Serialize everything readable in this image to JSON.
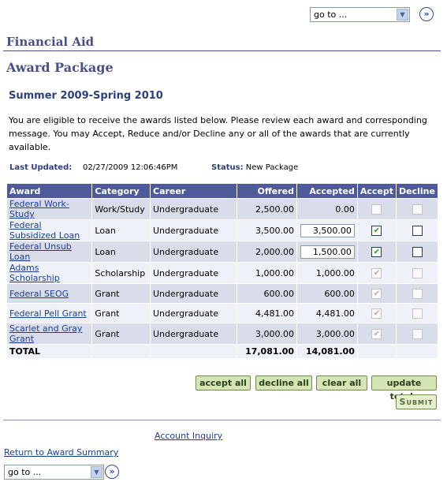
{
  "nav": {
    "goto_top": "go to ...",
    "goto_bottom": "go to ...",
    "go_button": "»"
  },
  "header": {
    "section_title": "Financial Aid",
    "page_title": "Award Package"
  },
  "term": "Summer 2009-Spring 2010",
  "intro": "You are eligible to receive the awards listed below. Please review each award and corresponding message. You may Accept, Reduce and/or Decline any or all of the awards that are currently available.",
  "meta": {
    "last_updated_label": "Last Updated:",
    "last_updated_value": "02/27/2009 12:06:46PM",
    "status_label": "Status:",
    "status_value": "New Package"
  },
  "table": {
    "headers": [
      "Award",
      "Category",
      "Career",
      "Offered",
      "Accepted",
      "Accept",
      "Decline"
    ],
    "rows": [
      {
        "award": "Federal Work-Study",
        "category": "Work/Study",
        "career": "Undergraduate",
        "offered": "2,500.00",
        "accepted": "0.00",
        "editable": false,
        "accept_checked": false,
        "accept_enabled": false,
        "decline_checked": false,
        "decline_enabled": false
      },
      {
        "award": "Federal Subsidized Loan",
        "category": "Loan",
        "career": "Undergraduate",
        "offered": "3,500.00",
        "accepted": "3,500.00",
        "editable": true,
        "accept_checked": true,
        "accept_enabled": true,
        "decline_checked": false,
        "decline_enabled": true
      },
      {
        "award": "Federal Unsub Loan",
        "category": "Loan",
        "career": "Undergraduate",
        "offered": "2,000.00",
        "accepted": "1,500.00",
        "editable": true,
        "accept_checked": true,
        "accept_enabled": true,
        "decline_checked": false,
        "decline_enabled": true
      },
      {
        "award": "Adams Scholarship",
        "category": "Scholarship",
        "career": "Undergraduate",
        "offered": "1,000.00",
        "accepted": "1,000.00",
        "editable": false,
        "accept_checked": true,
        "accept_enabled": false,
        "decline_checked": false,
        "decline_enabled": false
      },
      {
        "award": "Federal SEOG",
        "category": "Grant",
        "career": "Undergraduate",
        "offered": "600.00",
        "accepted": "600.00",
        "editable": false,
        "accept_checked": true,
        "accept_enabled": false,
        "decline_checked": false,
        "decline_enabled": false
      },
      {
        "award": "Federal Pell Grant",
        "category": "Grant",
        "career": "Undergraduate",
        "offered": "4,481.00",
        "accepted": "4,481.00",
        "editable": false,
        "accept_checked": true,
        "accept_enabled": false,
        "decline_checked": false,
        "decline_enabled": false
      },
      {
        "award": "Scarlet and Gray Grant",
        "category": "Grant",
        "career": "Undergraduate",
        "offered": "3,000.00",
        "accepted": "3,000.00",
        "editable": false,
        "accept_checked": true,
        "accept_enabled": false,
        "decline_checked": false,
        "decline_enabled": false
      }
    ],
    "total_label": "TOTAL",
    "total_offered": "17,081.00",
    "total_accepted": "14,081.00"
  },
  "buttons": {
    "accept_all": "accept all",
    "decline_all": "decline all",
    "clear_all": "clear all",
    "update_totals": "update totals",
    "submit": "Submit"
  },
  "footer": {
    "account_inquiry": "Account Inquiry",
    "return_link": "Return to Award Summary"
  },
  "colors": {
    "header_bg": "#4e5a9a",
    "title": "#4a4f87",
    "link": "#1c3f94",
    "button_bg": "#d5e6b4"
  }
}
